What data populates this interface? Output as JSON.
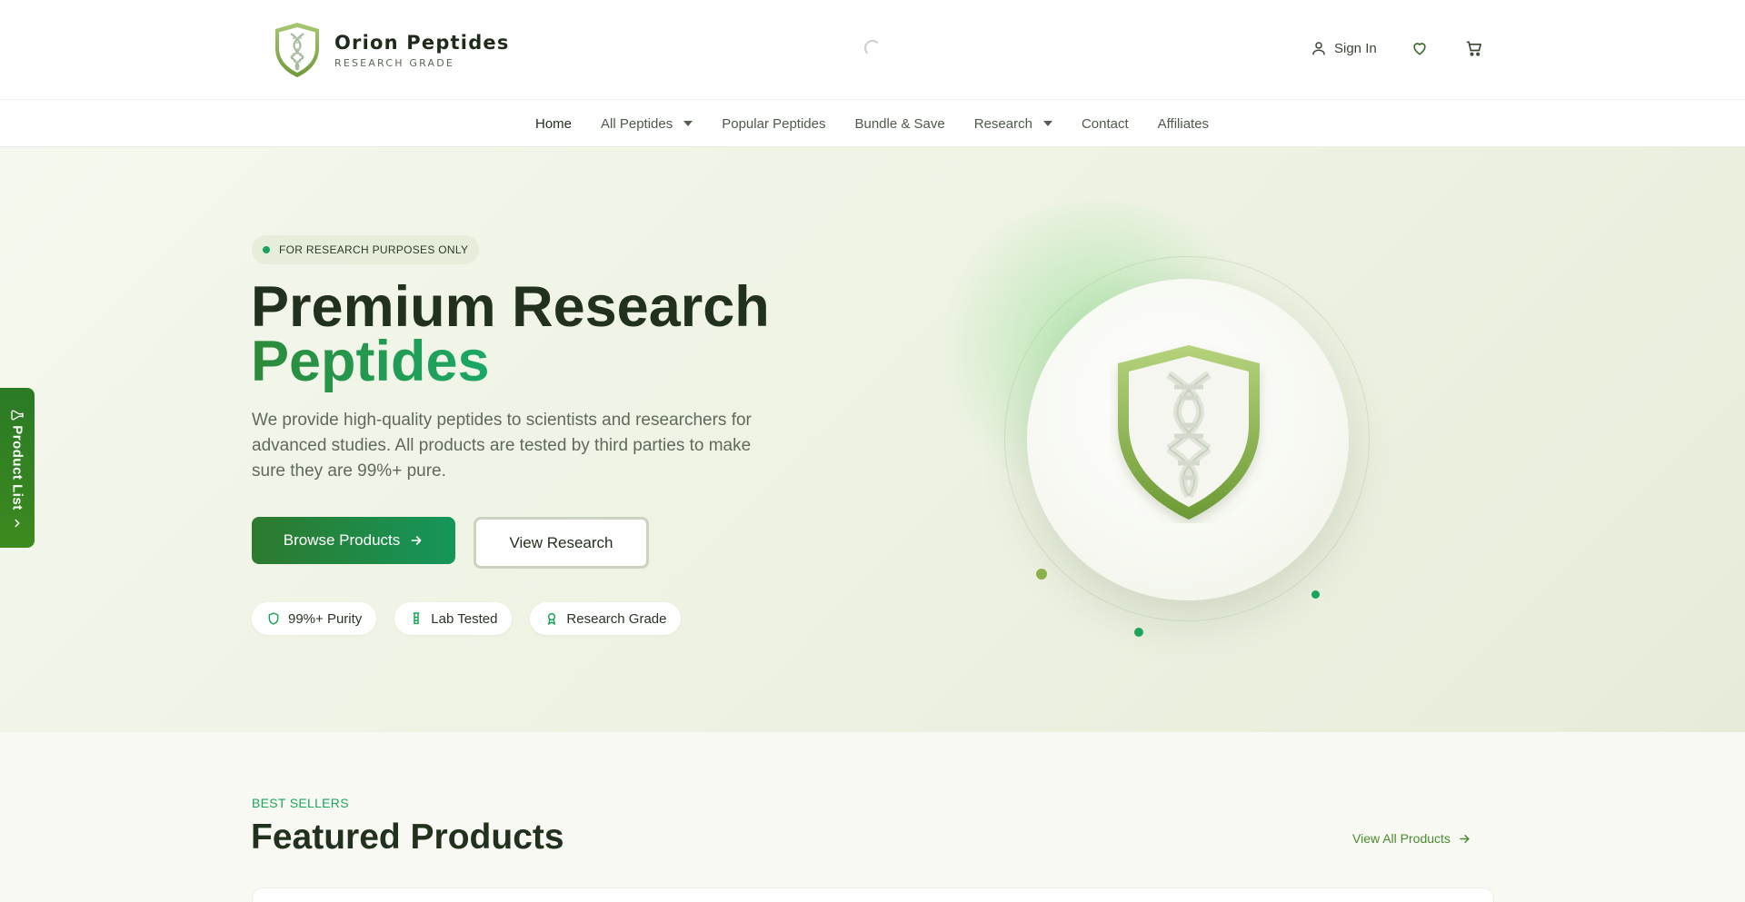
{
  "brand": {
    "name": "Orion Peptides",
    "tagline": "RESEARCH GRADE"
  },
  "header": {
    "sign_in": "Sign In",
    "wishlist_icon": "heart-icon",
    "cart_icon": "cart-icon",
    "user_icon": "user-icon"
  },
  "nav": {
    "items": [
      {
        "label": "Home",
        "active": true,
        "dropdown": false
      },
      {
        "label": "All Peptides",
        "active": false,
        "dropdown": true
      },
      {
        "label": "Popular Peptides",
        "active": false,
        "dropdown": false
      },
      {
        "label": "Bundle & Save",
        "active": false,
        "dropdown": false
      },
      {
        "label": "Research",
        "active": false,
        "dropdown": true
      },
      {
        "label": "Contact",
        "active": false,
        "dropdown": false
      },
      {
        "label": "Affiliates",
        "active": false,
        "dropdown": false
      }
    ]
  },
  "hero": {
    "notice": "FOR RESEARCH PURPOSES ONLY",
    "title_line1": "Premium Research",
    "title_line2": "Peptides",
    "description": "We provide high-quality peptides to scientists and researchers for advanced studies. All products are tested by third parties to make sure they are 99%+ pure.",
    "primary_cta": "Browse Products",
    "secondary_cta": "View Research",
    "badges": [
      {
        "label": "99%+ Purity",
        "icon": "shield-icon"
      },
      {
        "label": "Lab Tested",
        "icon": "beaker-icon"
      },
      {
        "label": "Research Grade",
        "icon": "award-icon"
      }
    ]
  },
  "side_tab": {
    "label": "Product List",
    "icon": "flask-icon"
  },
  "featured": {
    "eyebrow": "BEST SELLERS",
    "title": "Featured Products",
    "view_all": "View All Products"
  },
  "colors": {
    "accent": "#1ea55c",
    "brand_dark": "#2d7a2e",
    "heading": "#22301e",
    "olive": "#8bb04a"
  }
}
